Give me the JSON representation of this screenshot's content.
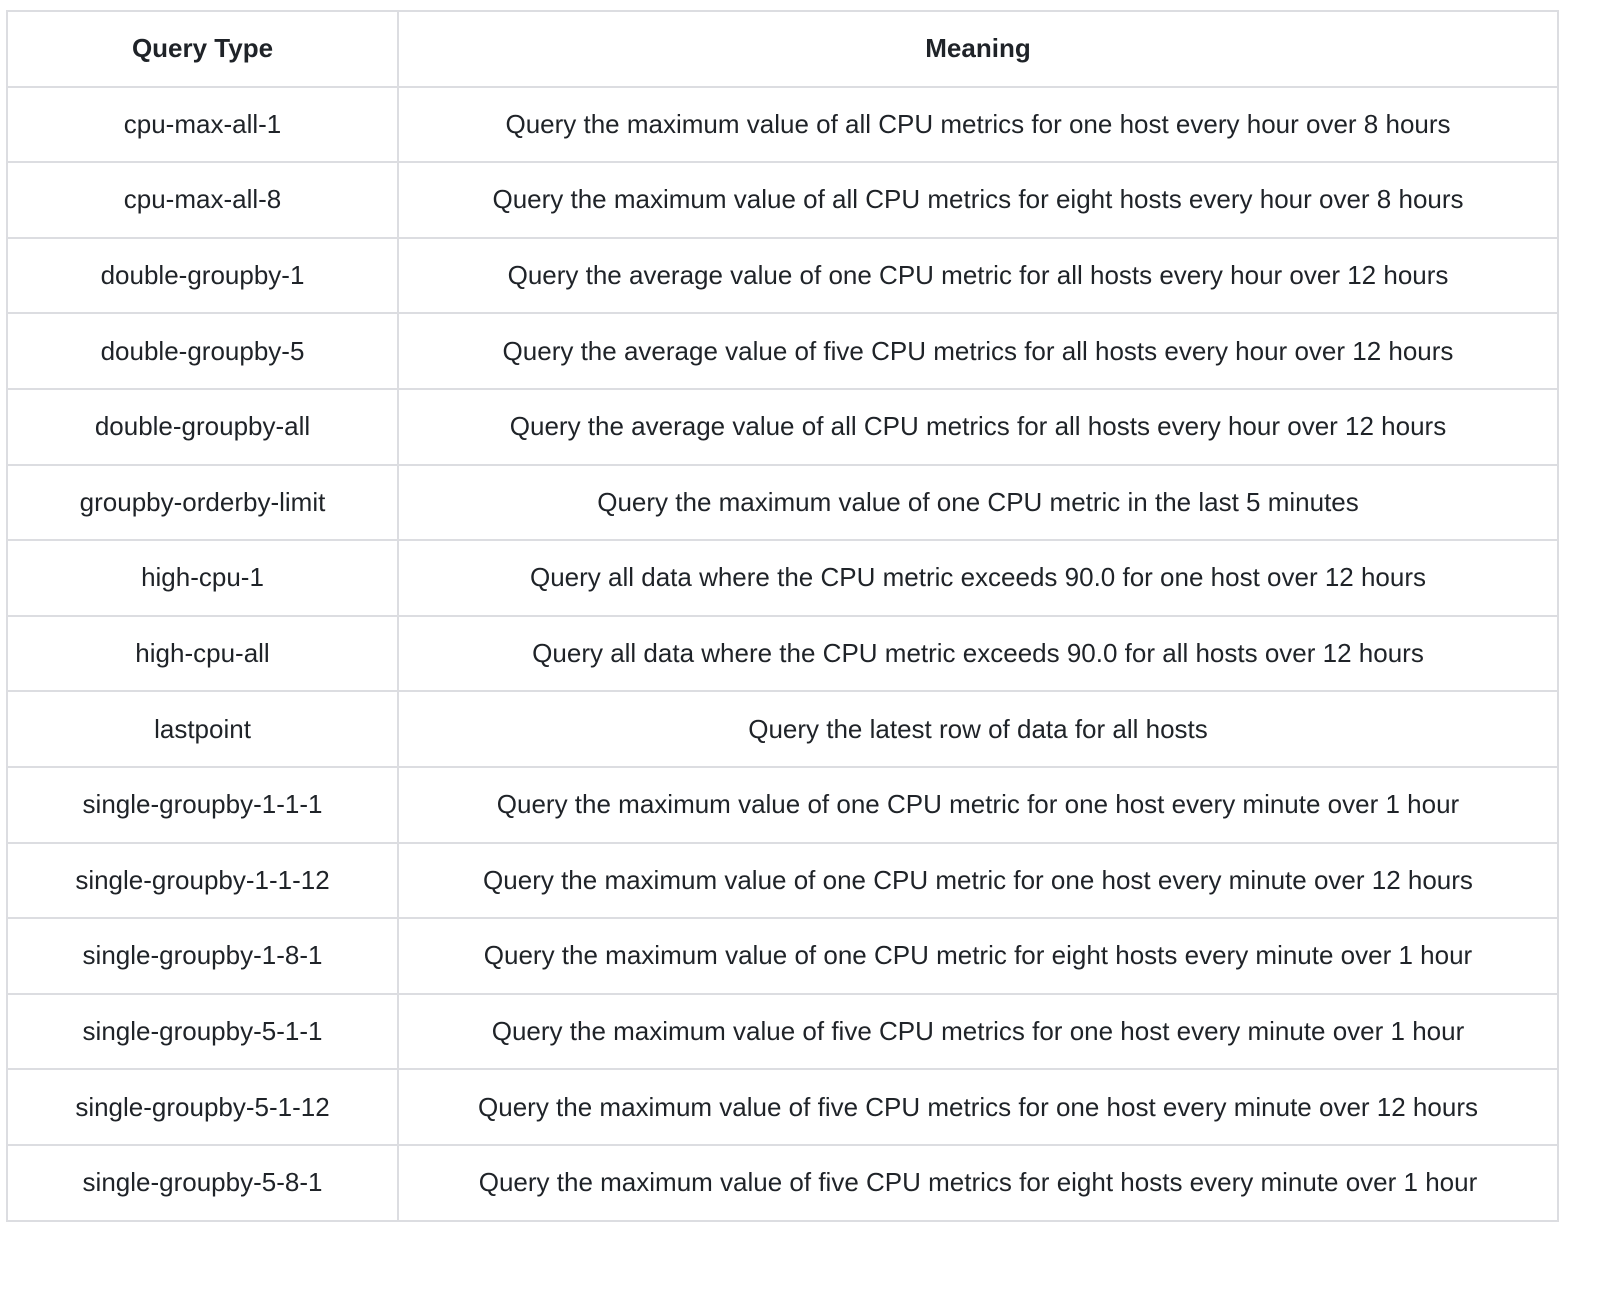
{
  "table": {
    "headers": [
      "Query Type",
      "Meaning"
    ],
    "rows": [
      [
        "cpu-max-all-1",
        "Query the maximum value of all CPU metrics for one host every hour over 8 hours"
      ],
      [
        "cpu-max-all-8",
        "Query the maximum value of all CPU metrics for eight hosts every hour over 8 hours"
      ],
      [
        "double-groupby-1",
        "Query the average value of one CPU metric for all hosts every hour over 12 hours"
      ],
      [
        "double-groupby-5",
        "Query the average value of five CPU metrics for all hosts every hour over 12 hours"
      ],
      [
        "double-groupby-all",
        "Query the average value of all CPU metrics for all hosts every hour over 12 hours"
      ],
      [
        "groupby-orderby-limit",
        "Query the maximum value of one CPU metric in the last 5 minutes"
      ],
      [
        "high-cpu-1",
        "Query all data where the CPU metric exceeds 90.0 for one host over 12 hours"
      ],
      [
        "high-cpu-all",
        "Query all data where the CPU metric exceeds 90.0 for all hosts over 12 hours"
      ],
      [
        "lastpoint",
        "Query the latest row of data for all hosts"
      ],
      [
        "single-groupby-1-1-1",
        "Query the maximum value of one CPU metric for one host every minute over 1 hour"
      ],
      [
        "single-groupby-1-1-12",
        "Query the maximum value of one CPU metric for one host every minute over 12 hours"
      ],
      [
        "single-groupby-1-8-1",
        "Query the maximum value of one CPU metric for eight hosts every minute over 1 hour"
      ],
      [
        "single-groupby-5-1-1",
        "Query the maximum value of five CPU metrics for one host every minute over 1 hour"
      ],
      [
        "single-groupby-5-1-12",
        "Query the maximum value of five CPU metrics for one host every minute over 12 hours"
      ],
      [
        "single-groupby-5-8-1",
        "Query the maximum value of five CPU metrics for eight hosts every minute over 1 hour"
      ]
    ]
  }
}
